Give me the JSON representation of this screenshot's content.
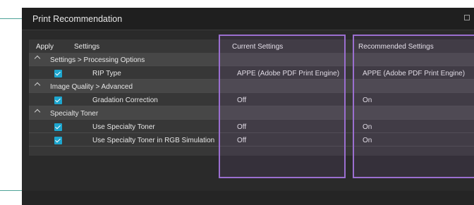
{
  "window": {
    "title": "Print Recommendation"
  },
  "table": {
    "headers": {
      "apply": "Apply",
      "settings": "Settings",
      "current": "Current Settings",
      "recommended": "Recommended Settings"
    },
    "groups": [
      {
        "label": "Settings > Processing Options",
        "rows": [
          {
            "checked": true,
            "setting": "RIP Type",
            "current": "APPE (Adobe PDF Print Engine)",
            "recommended": "APPE (Adobe PDF Print Engine)"
          }
        ]
      },
      {
        "label": "Image Quality > Advanced",
        "rows": [
          {
            "checked": true,
            "setting": "Gradation Correction",
            "current": "Off",
            "recommended": "On"
          }
        ]
      },
      {
        "label": "Specialty Toner",
        "rows": [
          {
            "checked": true,
            "setting": "Use Specialty Toner",
            "current": "Off",
            "recommended": "On"
          },
          {
            "checked": true,
            "setting": "Use Specialty Toner in RGB Simulation",
            "current": "Off",
            "recommended": "On"
          }
        ]
      }
    ]
  },
  "colors": {
    "callout": "#4ea398",
    "highlight": "#9b6fd0",
    "checkbox": "#1da6cf"
  }
}
